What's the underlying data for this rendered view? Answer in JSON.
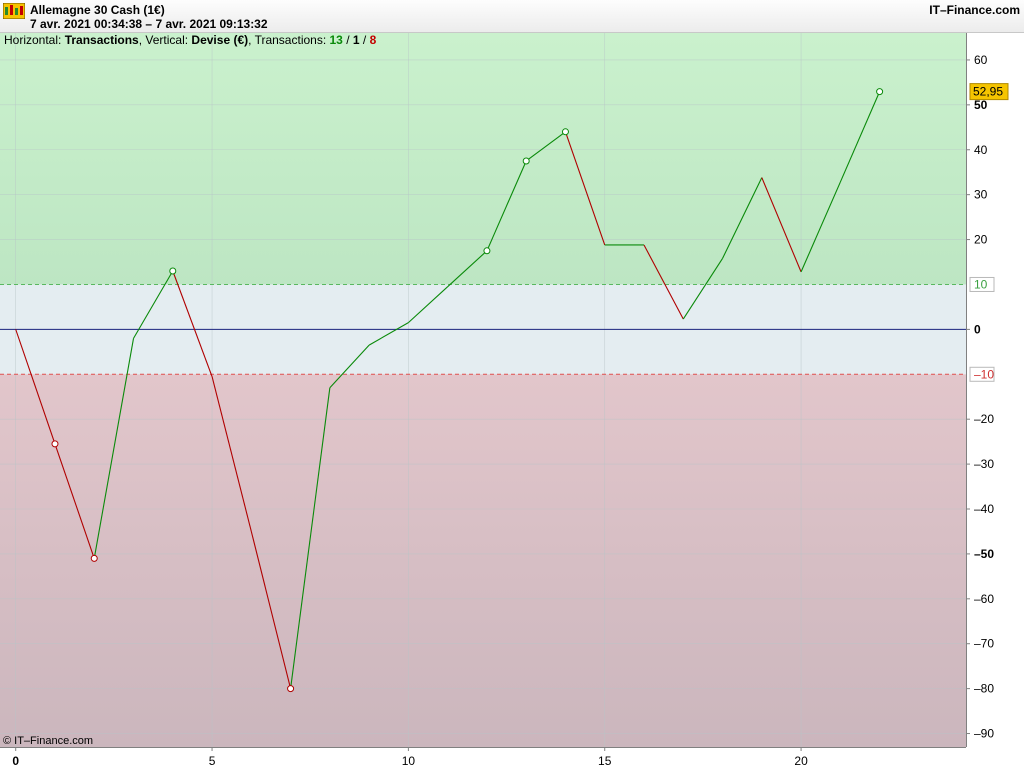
{
  "header": {
    "title": "Allemagne 30 Cash (1€)",
    "range": "7 avr. 2021 00:34:38 – 7 avr. 2021 09:13:32",
    "brand": "IT–Finance.com",
    "logo_icon": "demo-logo-icon"
  },
  "info": {
    "horizontal_label": "Horizontal: ",
    "horizontal_value": "Transactions",
    "vertical_label": ", Vertical: ",
    "vertical_value": "Devise (€)",
    "transactions_label": ", Transactions: ",
    "win": "13",
    "sep1": " / ",
    "neutral": "1",
    "sep2": " / ",
    "loss": "8"
  },
  "footer": {
    "copyright": "© IT–Finance.com"
  },
  "colors": {
    "zone_green": "#c4eec8",
    "zone_neutral": "#e4edf1",
    "zone_red": "#d6bcc3",
    "line_up": "#0a8a0a",
    "line_down": "#b00000",
    "zero_line": "#1a237e",
    "last_label_bg": "#f5c400"
  },
  "chart_data": {
    "type": "line",
    "x": [
      0,
      1,
      2,
      3,
      4,
      5,
      6,
      7,
      8,
      9,
      10,
      11,
      12,
      13,
      14,
      15,
      16,
      17,
      18,
      19,
      20,
      21,
      22
    ],
    "values": [
      0,
      -25.5,
      -51,
      -2,
      13,
      -10.5,
      -45,
      -80,
      -13,
      -3.5,
      1.5,
      9.5,
      17.5,
      37.5,
      44,
      18.8,
      18.8,
      2.3,
      15.8,
      33.8,
      12.8,
      32.8,
      52.95
    ],
    "markers": [
      {
        "x": 1,
        "y": -25.5,
        "dir": "down"
      },
      {
        "x": 2,
        "y": -51,
        "dir": "down"
      },
      {
        "x": 4,
        "y": 13,
        "dir": "up"
      },
      {
        "x": 7,
        "y": -80,
        "dir": "down"
      },
      {
        "x": 12,
        "y": 17.5,
        "dir": "up"
      },
      {
        "x": 13,
        "y": 37.5,
        "dir": "up"
      },
      {
        "x": 14,
        "y": 44,
        "dir": "up"
      },
      {
        "x": 22,
        "y": 52.95,
        "dir": "up"
      }
    ],
    "xlim": [
      -0.4,
      24.2
    ],
    "ylim": [
      -93,
      66
    ],
    "x_ticks": [
      0,
      5,
      10,
      15,
      20
    ],
    "x_tick_labels": [
      "0",
      "5",
      "10",
      "15",
      "20"
    ],
    "y_ticks": [
      60,
      50,
      40,
      30,
      20,
      0,
      -20,
      -30,
      -40,
      -50,
      -60,
      -70,
      -80,
      -90
    ],
    "y_tick_labels": [
      "60",
      "50",
      "40",
      "30",
      "20",
      "0",
      "–20",
      "–30",
      "–40",
      "–50",
      "–60",
      "–70",
      "–80",
      "–90"
    ],
    "bold_y_ticks": [
      50,
      -50
    ],
    "bold_x_ticks": [
      0
    ],
    "thresholds": {
      "upper": 10,
      "lower": -10,
      "upper_label": "10",
      "lower_label": "–10"
    },
    "last_value_label": "52,95",
    "grid": true
  }
}
